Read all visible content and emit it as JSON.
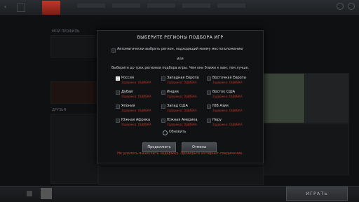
{
  "modal": {
    "title": "ВЫБЕРИТЕ РЕГИОНЫ ПОДБОРА ИГР",
    "auto_select_label": "Автоматически выбрать регион, подходящий моему местоположению",
    "or_label": "или",
    "instruction": "Выберите до трех регионов подбора игры. Чем они ближе к вам, тем лучше.",
    "regions": [
      {
        "name": "Россия",
        "latency": "Задержка: ОШИБКА",
        "checked": true
      },
      {
        "name": "Западная Европа",
        "latency": "Задержка: ОШИБКА",
        "checked": false
      },
      {
        "name": "Восточная Европа",
        "latency": "Задержка: ОШИБКА",
        "checked": false
      },
      {
        "name": "Дубай",
        "latency": "Задержка: ОШИБКА",
        "checked": false
      },
      {
        "name": "Индия",
        "latency": "Задержка: ОШИБКА",
        "checked": false
      },
      {
        "name": "Восток США",
        "latency": "Задержка: ОШИБКА",
        "checked": false
      },
      {
        "name": "Япония",
        "latency": "Задержка: ОШИБКА",
        "checked": false
      },
      {
        "name": "Запад США",
        "latency": "Задержка: ОШИБКА",
        "checked": false
      },
      {
        "name": "ЮВ Азия",
        "latency": "Задержка: ОШИБКА",
        "checked": false
      },
      {
        "name": "Южная Африка",
        "latency": "Задержка: ОШИБКА",
        "checked": false
      },
      {
        "name": "Южная Америка",
        "latency": "Задержка: ОШИБКА",
        "checked": false
      },
      {
        "name": "Перу",
        "latency": "Задержка: ОШИБКА",
        "checked": false
      }
    ],
    "refresh_label": "Обновить",
    "continue_label": "Продолжить",
    "cancel_label": "Отмена",
    "error_text": "Не удалось вычислить задержку. Проверьте интернет-соединение."
  },
  "background": {
    "my_profile_label": "МОЙ ПРОФИЛЬ",
    "friends_label": "ДРУЗЬЯ"
  },
  "footer": {
    "play_label": "ИГРАТЬ"
  },
  "colors": {
    "accent_red": "#c0392b",
    "error_red": "#d13c2e"
  }
}
